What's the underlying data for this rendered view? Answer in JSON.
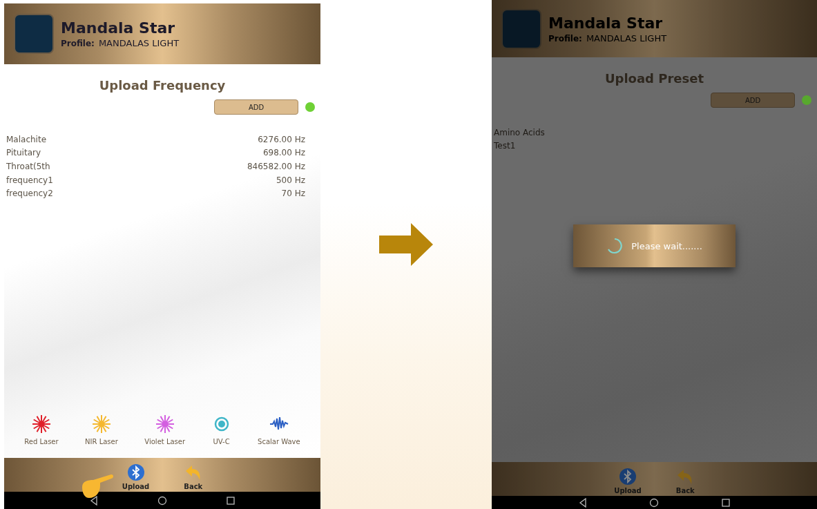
{
  "screens": [
    {
      "app_name": "Mandala Star",
      "profile_label": "Profile:",
      "profile_value": "MANDALAS LIGHT",
      "title": "Upload Frequency",
      "add_button": "ADD",
      "status_dot": {
        "color": "#6fd136"
      },
      "dimmed": false,
      "items": [
        {
          "name": "Malachite",
          "value": "6276.00 Hz"
        },
        {
          "name": "Pituitary",
          "value": "698.00 Hz"
        },
        {
          "name": "Throat(5th",
          "value": "846582.00 Hz"
        },
        {
          "name": "frequency1",
          "value": "500 Hz"
        },
        {
          "name": "frequency2",
          "value": "70 Hz"
        }
      ],
      "modes": [
        {
          "label": "Red Laser",
          "kind": "laser",
          "color": "#e0202a"
        },
        {
          "label": "NIR Laser",
          "kind": "laser",
          "color": "#f5b82e"
        },
        {
          "label": "Violet Laser",
          "kind": "laser",
          "color": "#d35ee0"
        },
        {
          "label": "UV-C",
          "kind": "uvc",
          "color": "#3fb6c8"
        },
        {
          "label": "Scalar Wave",
          "kind": "wave",
          "color": "#2b5fc4"
        }
      ],
      "bottom_buttons": [
        {
          "label": "Upload",
          "kind": "bluetooth",
          "pointed_at": true
        },
        {
          "label": "Back",
          "kind": "back",
          "pointed_at": false
        }
      ]
    },
    {
      "app_name": "Mandala Star",
      "profile_label": "Profile:",
      "profile_value": "MANDALAS LIGHT",
      "title": "Upload Preset",
      "add_button": "ADD",
      "status_dot": {
        "color": "#58a82e"
      },
      "dimmed": true,
      "items": [
        {
          "name": "Amino Acids"
        },
        {
          "name": "Test1"
        }
      ],
      "dialog": {
        "message": "Please wait......."
      },
      "bottom_buttons": [
        {
          "label": "Upload",
          "kind": "bluetooth",
          "pointed_at": false
        },
        {
          "label": "Back",
          "kind": "back",
          "pointed_at": false
        }
      ]
    }
  ]
}
